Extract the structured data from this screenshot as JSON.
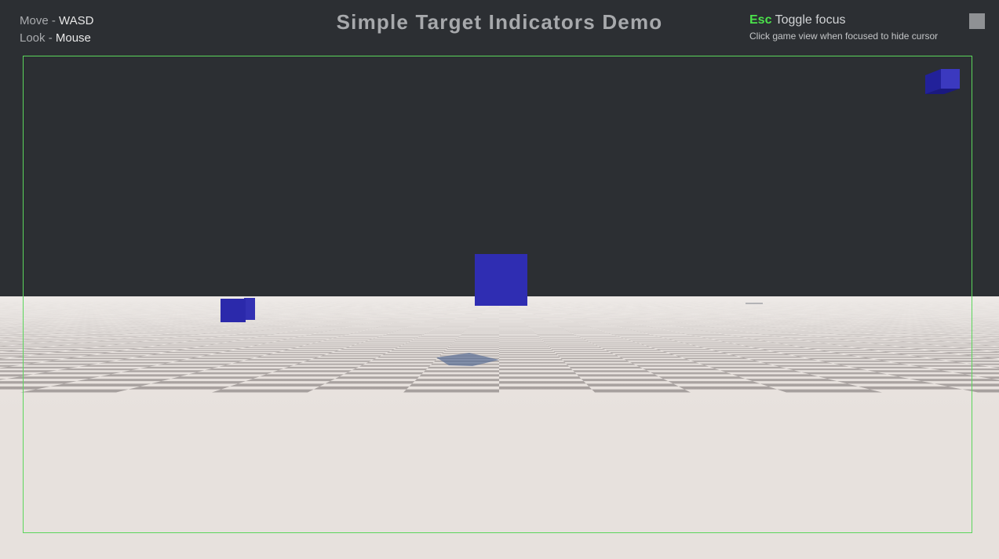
{
  "hud": {
    "controls": [
      {
        "action": "Move",
        "sep": " - ",
        "key": "WASD"
      },
      {
        "action": "Look",
        "sep": " - ",
        "key": "Mouse"
      }
    ],
    "title": "Simple Target Indicators Demo",
    "focus": {
      "key": "Esc",
      "label": "Toggle focus",
      "hint": "Click game view when focused to hide cursor"
    }
  },
  "colors": {
    "sky": "#2c2f33",
    "floor_light": "#e7e1dd",
    "floor_dark": "#9f9896",
    "target_blue": "#2f2db2",
    "focus_frame": "#5bd65b",
    "esc_key": "#4be24b"
  },
  "icons": {
    "focus_toggle": "square-icon"
  }
}
